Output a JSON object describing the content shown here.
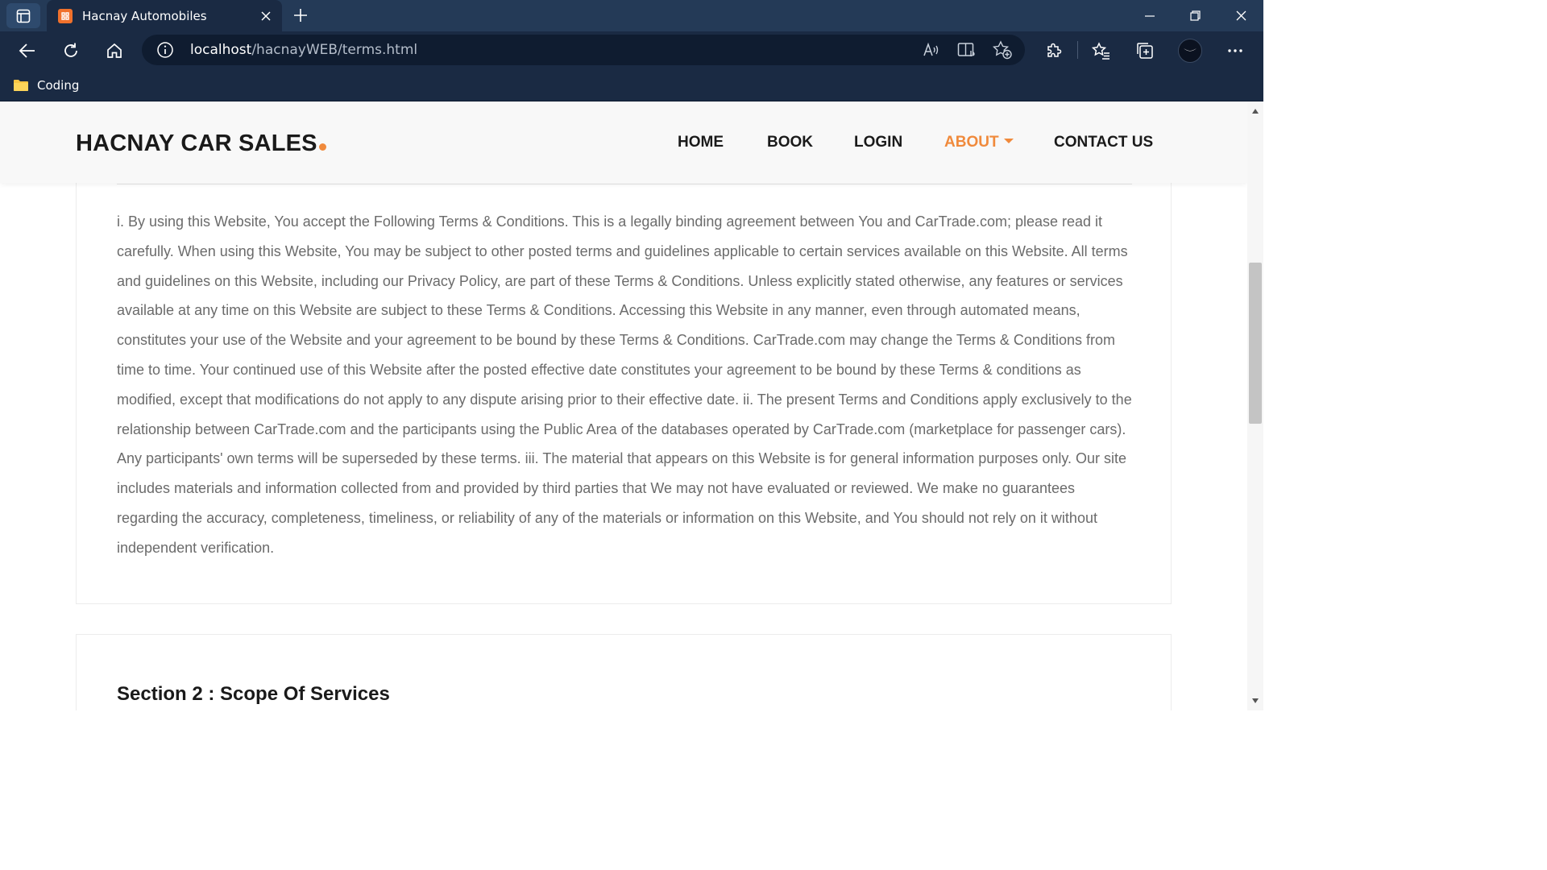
{
  "browser": {
    "tab_title": "Hacnay Automobiles",
    "address": {
      "host": "localhost",
      "path": "/hacnayWEB/terms.html"
    },
    "bookmarks": [
      {
        "label": "Coding"
      }
    ]
  },
  "header": {
    "brand": "HACNAY CAR SALES",
    "nav": [
      {
        "label": "HOME"
      },
      {
        "label": "BOOK"
      },
      {
        "label": "LOGIN"
      },
      {
        "label": "ABOUT",
        "active": true,
        "has_dropdown": true
      },
      {
        "label": "CONTACT US"
      }
    ],
    "accent_color": "#f08a3c"
  },
  "content": {
    "terms_paragraph": "i. By using this Website, You accept the Following Terms & Conditions. This is a legally binding agreement between You and CarTrade.com; please read it carefully. When using this Website, You may be subject to other posted terms and guidelines applicable to certain services available on this Website. All terms and guidelines on this Website, including our Privacy Policy, are part of these Terms & Conditions. Unless explicitly stated otherwise, any features or services available at any time on this Website are subject to these Terms & Conditions. Accessing this Website in any manner, even through automated means, constitutes your use of the Website and your agreement to be bound by these Terms & Conditions. CarTrade.com may change the Terms & Conditions from time to time. Your continued use of this Website after the posted effective date constitutes your agreement to be bound by these Terms & conditions as modified, except that modifications do not apply to any dispute arising prior to their effective date. ii. The present Terms and Conditions apply exclusively to the relationship between CarTrade.com and the participants using the Public Area of the databases operated by CarTrade.com (marketplace for passenger cars). Any participants' own terms will be superseded by these terms. iii. The material that appears on this Website is for general information purposes only. Our site includes materials and information collected from and provided by third parties that We may not have evaluated or reviewed. We make no guarantees regarding the accuracy, completeness, timeliness, or reliability of any of the materials or information on this Website, and You should not rely on it without independent verification.",
    "section_2_title": "Section 2 : Scope Of Services"
  }
}
